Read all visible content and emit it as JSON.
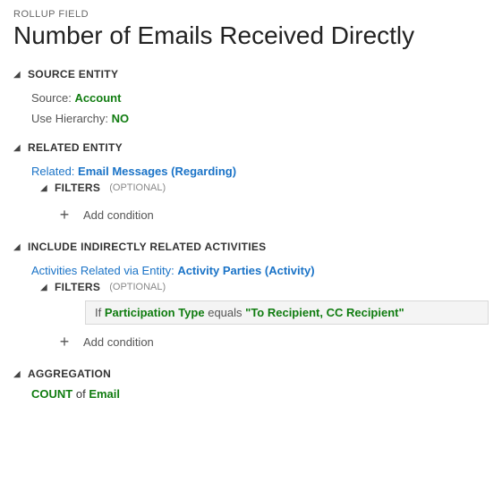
{
  "header": {
    "breadcrumb": "ROLLUP FIELD",
    "title": "Number of Emails Received Directly"
  },
  "sourceEntity": {
    "heading": "SOURCE ENTITY",
    "sourceLabel": "Source:",
    "sourceValue": "Account",
    "hierarchyLabel": "Use Hierarchy:",
    "hierarchyValue": "NO"
  },
  "relatedEntity": {
    "heading": "RELATED ENTITY",
    "relatedLabel": "Related:",
    "relatedValue": "Email Messages",
    "relatedParen": "Regarding",
    "filters": {
      "heading": "FILTERS",
      "hint": "(OPTIONAL)",
      "addCondition": "Add condition"
    }
  },
  "indirect": {
    "heading": "INCLUDE INDIRECTLY RELATED ACTIVITIES",
    "relatedViaLabel": "Activities Related via Entity:",
    "relatedViaValue": "Activity Parties",
    "relatedViaParen": "Activity",
    "filters": {
      "heading": "FILTERS",
      "hint": "(OPTIONAL)",
      "condition": {
        "if": "If",
        "field": "Participation Type",
        "op": "equals",
        "value": "\"To Recipient, CC Recipient\""
      },
      "addCondition": "Add condition"
    }
  },
  "aggregation": {
    "heading": "AGGREGATION",
    "fn": "COUNT",
    "of": "of",
    "target": "Email"
  }
}
